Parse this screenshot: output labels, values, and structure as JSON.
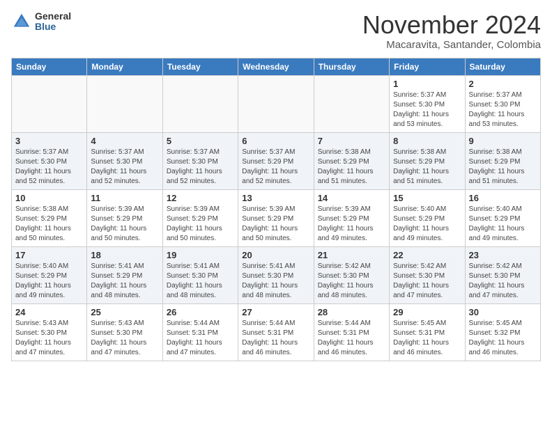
{
  "logo": {
    "general": "General",
    "blue": "Blue"
  },
  "title": "November 2024",
  "location": "Macaravita, Santander, Colombia",
  "weekdays": [
    "Sunday",
    "Monday",
    "Tuesday",
    "Wednesday",
    "Thursday",
    "Friday",
    "Saturday"
  ],
  "weeks": [
    [
      {
        "day": "",
        "info": ""
      },
      {
        "day": "",
        "info": ""
      },
      {
        "day": "",
        "info": ""
      },
      {
        "day": "",
        "info": ""
      },
      {
        "day": "",
        "info": ""
      },
      {
        "day": "1",
        "info": "Sunrise: 5:37 AM\nSunset: 5:30 PM\nDaylight: 11 hours\nand 53 minutes."
      },
      {
        "day": "2",
        "info": "Sunrise: 5:37 AM\nSunset: 5:30 PM\nDaylight: 11 hours\nand 53 minutes."
      }
    ],
    [
      {
        "day": "3",
        "info": "Sunrise: 5:37 AM\nSunset: 5:30 PM\nDaylight: 11 hours\nand 52 minutes."
      },
      {
        "day": "4",
        "info": "Sunrise: 5:37 AM\nSunset: 5:30 PM\nDaylight: 11 hours\nand 52 minutes."
      },
      {
        "day": "5",
        "info": "Sunrise: 5:37 AM\nSunset: 5:30 PM\nDaylight: 11 hours\nand 52 minutes."
      },
      {
        "day": "6",
        "info": "Sunrise: 5:37 AM\nSunset: 5:29 PM\nDaylight: 11 hours\nand 52 minutes."
      },
      {
        "day": "7",
        "info": "Sunrise: 5:38 AM\nSunset: 5:29 PM\nDaylight: 11 hours\nand 51 minutes."
      },
      {
        "day": "8",
        "info": "Sunrise: 5:38 AM\nSunset: 5:29 PM\nDaylight: 11 hours\nand 51 minutes."
      },
      {
        "day": "9",
        "info": "Sunrise: 5:38 AM\nSunset: 5:29 PM\nDaylight: 11 hours\nand 51 minutes."
      }
    ],
    [
      {
        "day": "10",
        "info": "Sunrise: 5:38 AM\nSunset: 5:29 PM\nDaylight: 11 hours\nand 50 minutes."
      },
      {
        "day": "11",
        "info": "Sunrise: 5:39 AM\nSunset: 5:29 PM\nDaylight: 11 hours\nand 50 minutes."
      },
      {
        "day": "12",
        "info": "Sunrise: 5:39 AM\nSunset: 5:29 PM\nDaylight: 11 hours\nand 50 minutes."
      },
      {
        "day": "13",
        "info": "Sunrise: 5:39 AM\nSunset: 5:29 PM\nDaylight: 11 hours\nand 50 minutes."
      },
      {
        "day": "14",
        "info": "Sunrise: 5:39 AM\nSunset: 5:29 PM\nDaylight: 11 hours\nand 49 minutes."
      },
      {
        "day": "15",
        "info": "Sunrise: 5:40 AM\nSunset: 5:29 PM\nDaylight: 11 hours\nand 49 minutes."
      },
      {
        "day": "16",
        "info": "Sunrise: 5:40 AM\nSunset: 5:29 PM\nDaylight: 11 hours\nand 49 minutes."
      }
    ],
    [
      {
        "day": "17",
        "info": "Sunrise: 5:40 AM\nSunset: 5:29 PM\nDaylight: 11 hours\nand 49 minutes."
      },
      {
        "day": "18",
        "info": "Sunrise: 5:41 AM\nSunset: 5:29 PM\nDaylight: 11 hours\nand 48 minutes."
      },
      {
        "day": "19",
        "info": "Sunrise: 5:41 AM\nSunset: 5:30 PM\nDaylight: 11 hours\nand 48 minutes."
      },
      {
        "day": "20",
        "info": "Sunrise: 5:41 AM\nSunset: 5:30 PM\nDaylight: 11 hours\nand 48 minutes."
      },
      {
        "day": "21",
        "info": "Sunrise: 5:42 AM\nSunset: 5:30 PM\nDaylight: 11 hours\nand 48 minutes."
      },
      {
        "day": "22",
        "info": "Sunrise: 5:42 AM\nSunset: 5:30 PM\nDaylight: 11 hours\nand 47 minutes."
      },
      {
        "day": "23",
        "info": "Sunrise: 5:42 AM\nSunset: 5:30 PM\nDaylight: 11 hours\nand 47 minutes."
      }
    ],
    [
      {
        "day": "24",
        "info": "Sunrise: 5:43 AM\nSunset: 5:30 PM\nDaylight: 11 hours\nand 47 minutes."
      },
      {
        "day": "25",
        "info": "Sunrise: 5:43 AM\nSunset: 5:30 PM\nDaylight: 11 hours\nand 47 minutes."
      },
      {
        "day": "26",
        "info": "Sunrise: 5:44 AM\nSunset: 5:31 PM\nDaylight: 11 hours\nand 47 minutes."
      },
      {
        "day": "27",
        "info": "Sunrise: 5:44 AM\nSunset: 5:31 PM\nDaylight: 11 hours\nand 46 minutes."
      },
      {
        "day": "28",
        "info": "Sunrise: 5:44 AM\nSunset: 5:31 PM\nDaylight: 11 hours\nand 46 minutes."
      },
      {
        "day": "29",
        "info": "Sunrise: 5:45 AM\nSunset: 5:31 PM\nDaylight: 11 hours\nand 46 minutes."
      },
      {
        "day": "30",
        "info": "Sunrise: 5:45 AM\nSunset: 5:32 PM\nDaylight: 11 hours\nand 46 minutes."
      }
    ]
  ]
}
